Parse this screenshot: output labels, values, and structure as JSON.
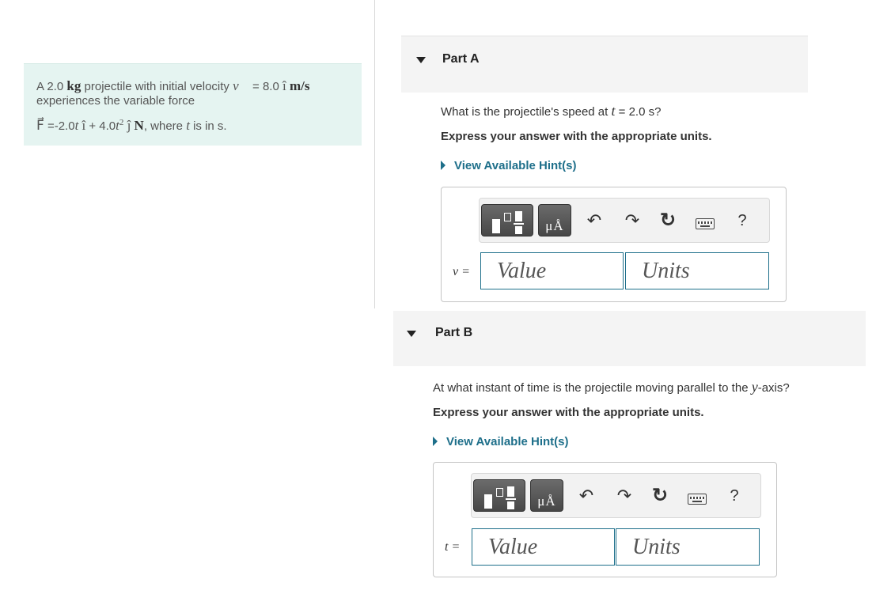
{
  "problem": {
    "line1": {
      "pre": "A 2.0 ",
      "kg": "kg",
      "mid": " projectile with initial velocity ",
      "v": "v⃗",
      "eq": " = 8.0 ",
      "ihat": "î",
      "units": " m/s"
    },
    "line2": "experiences the variable force",
    "line3": {
      "F": "F⃗",
      "a": " =-2.0",
      "t1": "t",
      "sp": " ",
      "ihat": "î",
      "b": " + 4.0",
      "t2": "t",
      "sq": "2",
      "sp2": " ",
      "jhat": "ĵ",
      "N": " N",
      "c": ", where ",
      "t3": "t",
      "d": " is in s."
    }
  },
  "partA": {
    "title": "Part A",
    "question": {
      "pre": "What is the projectile's speed at ",
      "t": "t",
      "post": " = 2.0 s?"
    },
    "instruction": "Express your answer with the appropriate units.",
    "hint": "View Available Hint(s)",
    "var_label": "v =",
    "value_placeholder": "Value",
    "units_placeholder": "Units"
  },
  "partB": {
    "title": "Part B",
    "question": {
      "pre": "At what instant of time is the projectile moving parallel to the ",
      "y": "y",
      "post": "-axis?"
    },
    "instruction": "Express your answer with the appropriate units.",
    "hint": "View Available Hint(s)",
    "var_label": "t =",
    "value_placeholder": "Value",
    "units_placeholder": "Units"
  },
  "toolbar": {
    "units_label": "μÅ",
    "help_label": "?",
    "undo_icon": "↶",
    "redo_icon": "↷",
    "reset_icon": "↻",
    "icons": [
      "templates-icon",
      "units-icon",
      "undo-icon",
      "redo-icon",
      "reset-icon",
      "keyboard-icon",
      "help-icon"
    ]
  },
  "colors": {
    "accent": "#1e6f8a",
    "problem_bg": "#e5f4f1",
    "header_bg": "#f4f4f4"
  }
}
